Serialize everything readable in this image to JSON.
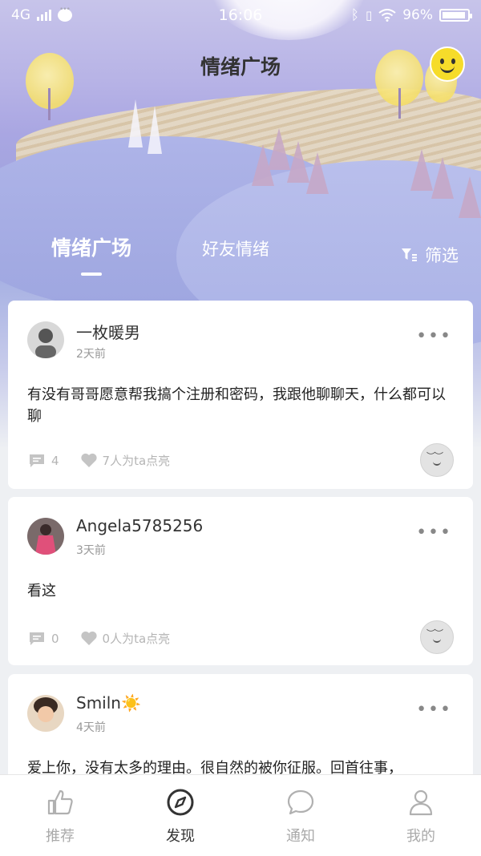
{
  "status_bar": {
    "network": "4G",
    "time": "16:06",
    "battery": "96%"
  },
  "header": {
    "title": "情绪广场"
  },
  "tabs": {
    "active": "情绪广场",
    "friends": "好友情绪",
    "filter_label": "筛选"
  },
  "posts": [
    {
      "user": "一枚暖男",
      "time": "2天前",
      "content": "有没有哥哥愿意帮我搞个注册和密码，我跟他聊聊天，什么都可以聊",
      "comments": "4",
      "likes": "7人为ta点亮"
    },
    {
      "user": "Angela5785256",
      "time": "3天前",
      "content": "看这",
      "comments": "0",
      "likes": "0人为ta点亮"
    },
    {
      "user": "Smiln☀️",
      "time": "4天前",
      "content": "爱上你，没有太多的理由。很自然的被你征服。回首往事，"
    }
  ],
  "tabbar": {
    "items": [
      {
        "label": "推荐",
        "icon": "thumbs-up-icon"
      },
      {
        "label": "发现",
        "icon": "compass-icon"
      },
      {
        "label": "通知",
        "icon": "chat-bubble-icon"
      },
      {
        "label": "我的",
        "icon": "person-icon"
      }
    ],
    "active_index": 1
  },
  "colors": {
    "accent_dark": "#333333",
    "inactive": "#aaaaaa",
    "smiley": "#f6dc2a"
  }
}
